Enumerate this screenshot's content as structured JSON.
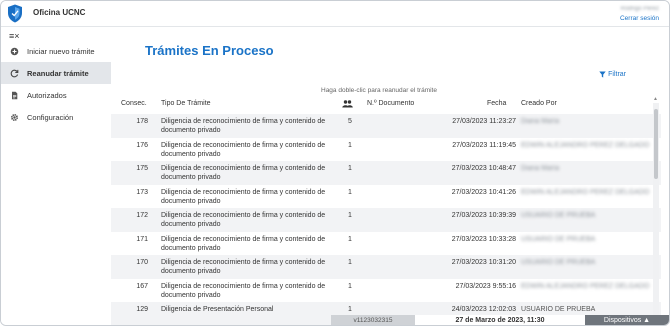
{
  "header": {
    "app_title": "Oficina UCNC",
    "user_name": "Rodrigo Perez",
    "logout_label": "Cerrar sesión"
  },
  "sidebar": {
    "collapse_icon": "collapse-menu-icon",
    "items": [
      {
        "label": "Iniciar nuevo trámite",
        "icon": "add-circle-icon",
        "active": false
      },
      {
        "label": "Reanudar trámite",
        "icon": "refresh-icon",
        "active": true
      },
      {
        "label": "Autorizados",
        "icon": "document-icon",
        "active": false
      },
      {
        "label": "Configuración",
        "icon": "gear-icon",
        "active": false
      }
    ]
  },
  "main": {
    "title": "Trámites En Proceso",
    "filter_label": "Filtrar",
    "hint": "Haga doble-clic para reanudar el trámite",
    "columns": {
      "consec": "Consec.",
      "tipo": "Tipo De Trámite",
      "people_icon": "people-icon",
      "numero": "N.º Documento",
      "fecha": "Fecha",
      "creado": "Creado Por"
    },
    "rows": [
      {
        "consec": "178",
        "tipo": "Diligencia de reconocimiento de firma y contenido de documento privado",
        "count": "5",
        "fecha": "27/03/2023 11:23:27",
        "creado": "Diana María",
        "blurred": true
      },
      {
        "consec": "176",
        "tipo": "Diligencia de reconocimiento de firma y contenido de documento privado",
        "count": "1",
        "fecha": "27/03/2023 11:19:45",
        "creado": "EDWIN ALEJANDRO PEREZ DELGADO",
        "blurred": true
      },
      {
        "consec": "175",
        "tipo": "Diligencia de reconocimiento de firma y contenido de documento privado",
        "count": "1",
        "fecha": "27/03/2023 10:48:47",
        "creado": "Diana María",
        "blurred": true
      },
      {
        "consec": "173",
        "tipo": "Diligencia de reconocimiento de firma y contenido de documento privado",
        "count": "1",
        "fecha": "27/03/2023 10:41:26",
        "creado": "EDWIN ALEJANDRO PEREZ DELGADO",
        "blurred": true
      },
      {
        "consec": "172",
        "tipo": "Diligencia de reconocimiento de firma y contenido de documento privado",
        "count": "1",
        "fecha": "27/03/2023 10:39:39",
        "creado": "USUARIO DE PRUEBA",
        "blurred": true
      },
      {
        "consec": "171",
        "tipo": "Diligencia de reconocimiento de firma y contenido de documento privado",
        "count": "1",
        "fecha": "27/03/2023 10:33:28",
        "creado": "USUARIO DE PRUEBA",
        "blurred": true
      },
      {
        "consec": "170",
        "tipo": "Diligencia de reconocimiento de firma y contenido de documento privado",
        "count": "1",
        "fecha": "27/03/2023 10:31:20",
        "creado": "USUARIO DE PRUEBA",
        "blurred": true
      },
      {
        "consec": "167",
        "tipo": "Diligencia de reconocimiento de firma y contenido de documento privado",
        "count": "1",
        "fecha": "27/03/2023 9:55:16",
        "creado": "EDWIN ALEJANDRO PEREZ DELGADO",
        "blurred": true
      },
      {
        "consec": "129",
        "tipo": "Diligencia de Presentación Personal",
        "count": "1",
        "fecha": "24/03/2023 12:02:03",
        "creado": "USUARIO DE PRUEBA",
        "blurred": false
      }
    ]
  },
  "footer": {
    "version": "v1123032315",
    "datetime": "27 de Marzo de 2023, 11:30",
    "devices_label": "Dispositivos ▲"
  },
  "colors": {
    "accent": "#1a73c7",
    "active_item_bg": "#e3e6ea",
    "footer_button": "#6f757c"
  }
}
